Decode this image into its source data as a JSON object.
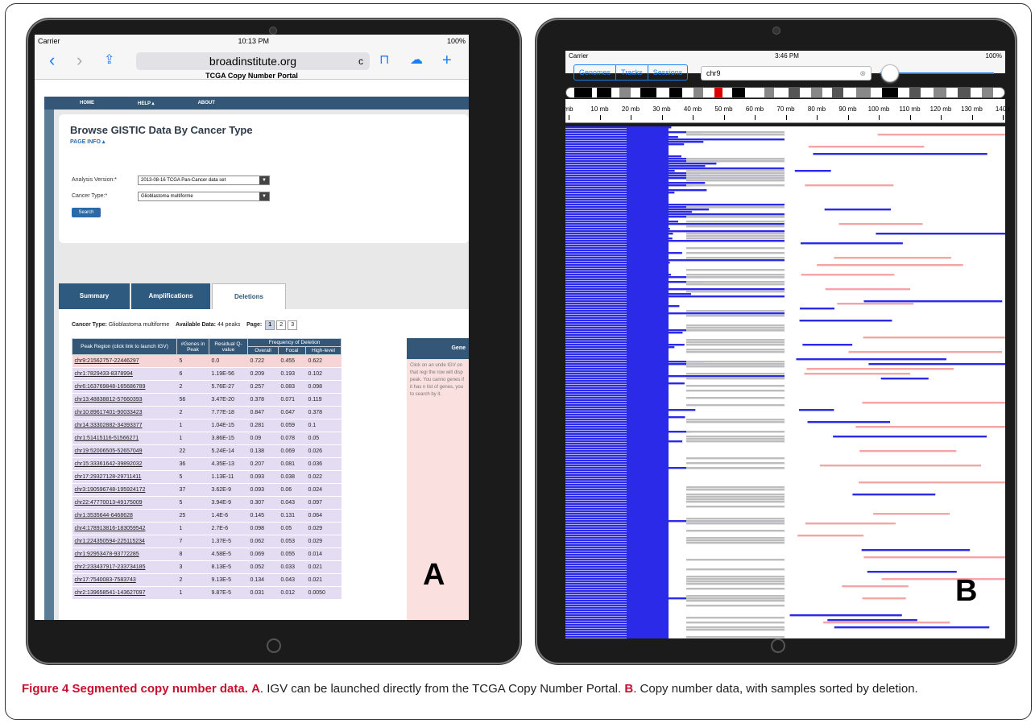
{
  "panelA": {
    "status": {
      "carrier": "Carrier",
      "time": "10:13 PM",
      "battery": "100%"
    },
    "url": "broadinstitute.org",
    "page_title": "TCGA Copy Number Portal",
    "nav": [
      "HOME",
      "HELP ▴",
      "ABOUT"
    ],
    "heading": "Browse GISTIC Data By Cancer Type",
    "page_info": "PAGE INFO ▴",
    "analysis_label": "Analysis Version:*",
    "analysis_value": "2013-08-16 TCGA Pan-Cancer data set",
    "cancer_label": "Cancer Type:*",
    "cancer_value": "Glioblastoma multiforme",
    "search_label": "Search",
    "tabs": [
      "Summary",
      "Amplifications",
      "Deletions"
    ],
    "info": {
      "cancer_type_label": "Cancer Type:",
      "cancer_type": "Glioblastoma multiforme",
      "available_label": "Available Data:",
      "available": "44 peaks",
      "page_label": "Page:",
      "pages": [
        "1",
        "2",
        "3"
      ]
    },
    "table": {
      "headers": {
        "peak": "Peak Region (click link to launch IGV)",
        "genes": "#Genes in Peak",
        "q": "Residual Q-value",
        "freq": "Frequency of Deletion",
        "overall": "Overall",
        "focal": "Focal",
        "high": "High-level"
      },
      "rows": [
        [
          "chr9:21562757-22446297",
          "5",
          "0.0",
          "0.722",
          "0.455",
          "0.622"
        ],
        [
          "chr1:7829433-8378994",
          "6",
          "1.19E-56",
          "0.209",
          "0.193",
          "0.102"
        ],
        [
          "chr6:163769848-165686789",
          "2",
          "5.76E-27",
          "0.257",
          "0.083",
          "0.098"
        ],
        [
          "chr13:48838812-57660393",
          "56",
          "3.47E-20",
          "0.378",
          "0.071",
          "0.119"
        ],
        [
          "chr10:89617401-90033423",
          "2",
          "7.77E-18",
          "0.847",
          "0.047",
          "0.378"
        ],
        [
          "chr14:33302882-34393377",
          "1",
          "1.04E-15",
          "0.281",
          "0.059",
          "0.1"
        ],
        [
          "chr1:51415116-51566271",
          "1",
          "3.86E-15",
          "0.09",
          "0.078",
          "0.05"
        ],
        [
          "chr19:52006505-52657049",
          "22",
          "5.24E-14",
          "0.138",
          "0.069",
          "0.026"
        ],
        [
          "chr15:33361642-39892032",
          "36",
          "4.35E-13",
          "0.207",
          "0.081",
          "0.036"
        ],
        [
          "chr17:29327128-29711411",
          "5",
          "1.13E-11",
          "0.093",
          "0.038",
          "0.022"
        ],
        [
          "chr3:190596748-195924172",
          "37",
          "3.62E-9",
          "0.093",
          "0.06",
          "0.024"
        ],
        [
          "chr22:47770013-49175009",
          "5",
          "3.94E-9",
          "0.307",
          "0.043",
          "0.097"
        ],
        [
          "chr1:3535644-6468628",
          "25",
          "1.4E-6",
          "0.145",
          "0.131",
          "0.064"
        ],
        [
          "chr4:178913816-183059542",
          "1",
          "2.7E-6",
          "0.098",
          "0.05",
          "0.029"
        ],
        [
          "chr1:224350594-225115234",
          "7",
          "1.37E-5",
          "0.062",
          "0.053",
          "0.029"
        ],
        [
          "chr1:92953478-93772285",
          "8",
          "4.58E-5",
          "0.069",
          "0.055",
          "0.014"
        ],
        [
          "chr2:233437917-233734185",
          "3",
          "8.13E-5",
          "0.052",
          "0.033",
          "0.021"
        ],
        [
          "chr17:7540083-7583743",
          "2",
          "9.13E-5",
          "0.134",
          "0.043",
          "0.021"
        ],
        [
          "chr2:139658541-143627097",
          "1",
          "9.87E-5",
          "0.031",
          "0.012",
          "0.0050"
        ]
      ]
    },
    "gene_panel_title": "Gene",
    "gene_panel_text": "Click on an unde IGV on that regi the row will disp peak. You canno genes if it has n list of genes, you to search by it.",
    "label": "A"
  },
  "panelB": {
    "status": {
      "carrier": "Carrier",
      "time": "3:46 PM",
      "battery": "100%"
    },
    "segments": [
      "Genomes",
      "Tracks",
      "Sessions"
    ],
    "locus": "chr9",
    "ruler": [
      "mb",
      "10 mb",
      "20 mb",
      "30 mb",
      "40 mb",
      "50 mb",
      "60 mb",
      "70 mb",
      "80 mb",
      "90 mb",
      "100 mb",
      "110 mb",
      "120 mb",
      "130 mb",
      "140 r"
    ],
    "label": "B",
    "colors": {
      "deletion": "#2a2ae8",
      "amplification": "#f4a6a6",
      "missing": "#bdbdbd"
    }
  },
  "caption": {
    "title": "Figure 4 Segmented copy number data.",
    "a_label": "A",
    "a_text": ". IGV can be launched directly from the TCGA Copy Number Portal.",
    "b_label": "B",
    "b_text": ". Copy number data, with samples sorted by deletion."
  }
}
